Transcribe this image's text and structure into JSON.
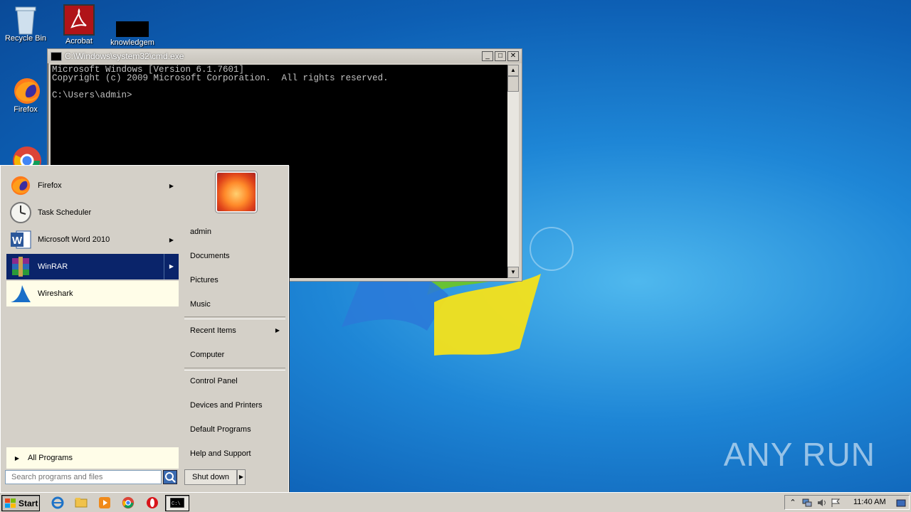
{
  "desktop": {
    "icons": [
      {
        "label": "Recycle Bin"
      },
      {
        "label": "Acrobat"
      },
      {
        "label": "knowledgem"
      },
      {
        "label": "Firefox"
      },
      {
        "label": ""
      }
    ],
    "watermark": "ANY RUN"
  },
  "cmd": {
    "title": "C:\\Windows\\system32\\cmd.exe",
    "lines": [
      "Microsoft Windows [Version 6.1.7601]",
      "Copyright (c) 2009 Microsoft Corporation.  All rights reserved.",
      "",
      "C:\\Users\\admin>"
    ]
  },
  "startmenu": {
    "programs": [
      {
        "label": "Firefox",
        "submenu": true
      },
      {
        "label": "Task Scheduler",
        "submenu": false
      },
      {
        "label": "Microsoft Word 2010",
        "submenu": true
      },
      {
        "label": "WinRAR",
        "submenu": true
      },
      {
        "label": "Wireshark",
        "submenu": false
      }
    ],
    "all_programs": "All Programs",
    "search_placeholder": "Search programs and files",
    "right_links": [
      {
        "label": "admin"
      },
      {
        "label": "Documents"
      },
      {
        "label": "Pictures"
      },
      {
        "label": "Music"
      },
      {
        "label": "Recent Items",
        "submenu": true
      },
      {
        "label": "Computer"
      },
      {
        "label": "Control Panel"
      },
      {
        "label": "Devices and Printers"
      },
      {
        "label": "Default Programs"
      },
      {
        "label": "Help and Support"
      }
    ],
    "shutdown": "Shut down"
  },
  "taskbar": {
    "start": "Start",
    "clock": "11:40 AM"
  },
  "colors": {
    "selection": "#0a246a",
    "hover": "#fffde8",
    "desktop": "#1e86d6"
  }
}
